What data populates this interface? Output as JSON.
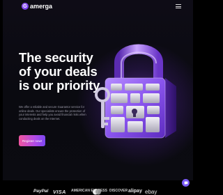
{
  "header": {
    "logo_mark": "G",
    "logo_text": "amerga",
    "menu_icon": "hamburger-menu-icon"
  },
  "hero": {
    "headline_line1": "The security",
    "headline_line2": "of your deals",
    "headline_line3": "is our priority",
    "description": "We offer a reliable and secure Guarantor service for online deals. Our specialists ensure the protection of your interests and help you avoid financial risks when conducting deals on the Internet.",
    "cta_label": "Register now!",
    "illustration": "padlock-with-key-icon"
  },
  "chat": {
    "icon": "chat-bubble-icon"
  },
  "partners": [
    "PayPal",
    "VISA",
    "AMERICAN EXPRESS",
    "mastercard",
    "DISCOVER",
    "alipay",
    "ebay"
  ],
  "colors": {
    "background": "#0a0a10",
    "accent_purple": "#7c47f2",
    "accent_pink": "#f0559e",
    "text_muted": "#9b9aa8"
  }
}
